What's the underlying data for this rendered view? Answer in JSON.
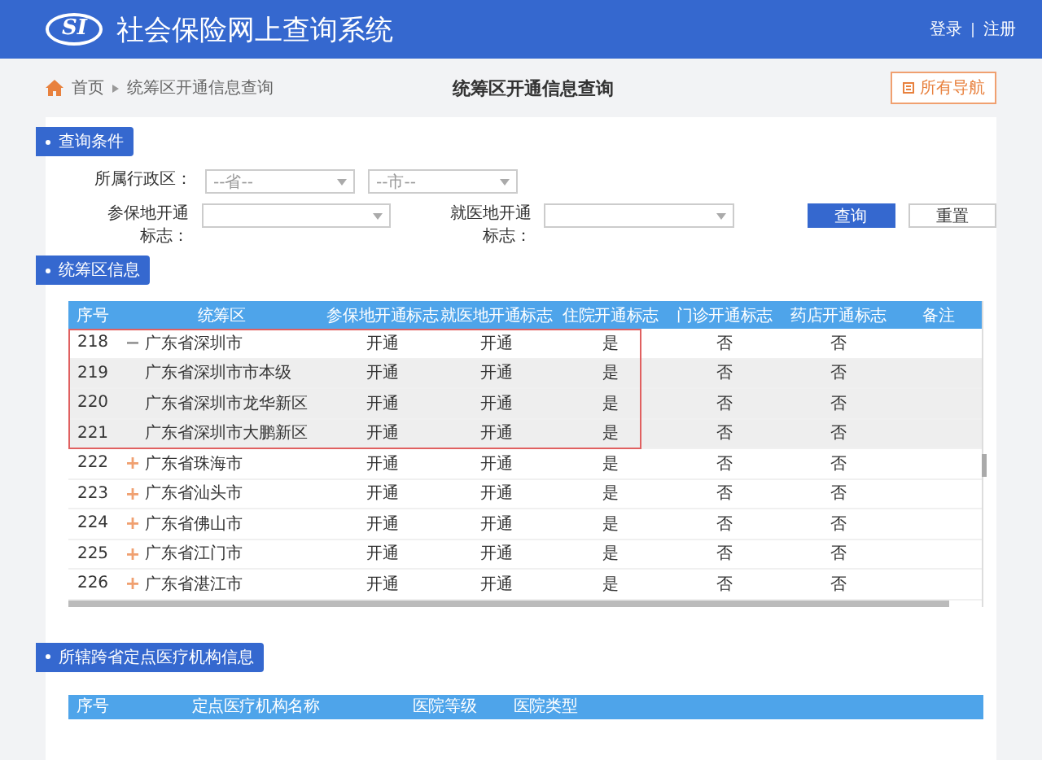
{
  "header": {
    "logo_text": "SI",
    "title": "社会保险网上查询系统",
    "links": [
      "登录",
      "注册"
    ]
  },
  "breadcrumb": [
    "首页",
    "统筹区开通信息查询"
  ],
  "page_title": "统筹区开通信息查询",
  "nav_button": "所有导航",
  "query": {
    "section": "查询条件",
    "region_label": "所属行政区：",
    "selects": [
      {
        "placeholder": "--省--"
      },
      {
        "placeholder": "--市--"
      }
    ],
    "filters": [
      {
        "label": "参保地开通标志："
      },
      {
        "label": "就医地开通标志："
      }
    ],
    "buttons": [
      {
        "label": "查询",
        "kind": "primary"
      },
      {
        "label": "重置",
        "kind": "secondary"
      }
    ]
  },
  "regions": {
    "section": "统筹区信息",
    "columns": [
      "序号",
      "统筹区",
      "参保地开通标志",
      "就医地开通标志",
      "住院开通标志",
      "门诊开通标志",
      "药店开通标志",
      "备注"
    ],
    "rows": [
      {
        "cells": [
          "218",
          "广东省深圳市",
          "开通",
          "开通",
          "是",
          "否",
          "否"
        ],
        "expanded": true,
        "highlighted": true,
        "children": [
          {
            "cells": [
              "219",
              "广东省深圳市市本级",
              "开通",
              "开通",
              "是",
              "否",
              "否"
            ]
          },
          {
            "cells": [
              "220",
              "广东省深圳市龙华新区",
              "开通",
              "开通",
              "是",
              "否",
              "否"
            ]
          },
          {
            "cells": [
              "221",
              "广东省深圳市大鹏新区",
              "开通",
              "开通",
              "是",
              "否",
              "否"
            ]
          }
        ]
      },
      {
        "cells": [
          "222",
          "广东省珠海市",
          "开通",
          "开通",
          "是",
          "否",
          "否"
        ],
        "expanded": false,
        "highlighted": false
      },
      {
        "cells": [
          "223",
          "广东省汕头市",
          "开通",
          "开通",
          "是",
          "否",
          "否"
        ],
        "expanded": false,
        "highlighted": false
      },
      {
        "cells": [
          "224",
          "广东省佛山市",
          "开通",
          "开通",
          "是",
          "否",
          "否"
        ],
        "expanded": false,
        "highlighted": false
      },
      {
        "cells": [
          "225",
          "广东省江门市",
          "开通",
          "开通",
          "是",
          "否",
          "否"
        ],
        "expanded": false,
        "highlighted": false
      },
      {
        "cells": [
          "226",
          "广东省湛江市",
          "开通",
          "开通",
          "是",
          "否",
          "否"
        ],
        "expanded": false,
        "highlighted": false
      }
    ]
  },
  "institutions": {
    "section": "所辖跨省定点医疗机构信息",
    "columns": [
      "序号",
      "定点医疗机构名称",
      "医院等级",
      "医院类型"
    ]
  }
}
